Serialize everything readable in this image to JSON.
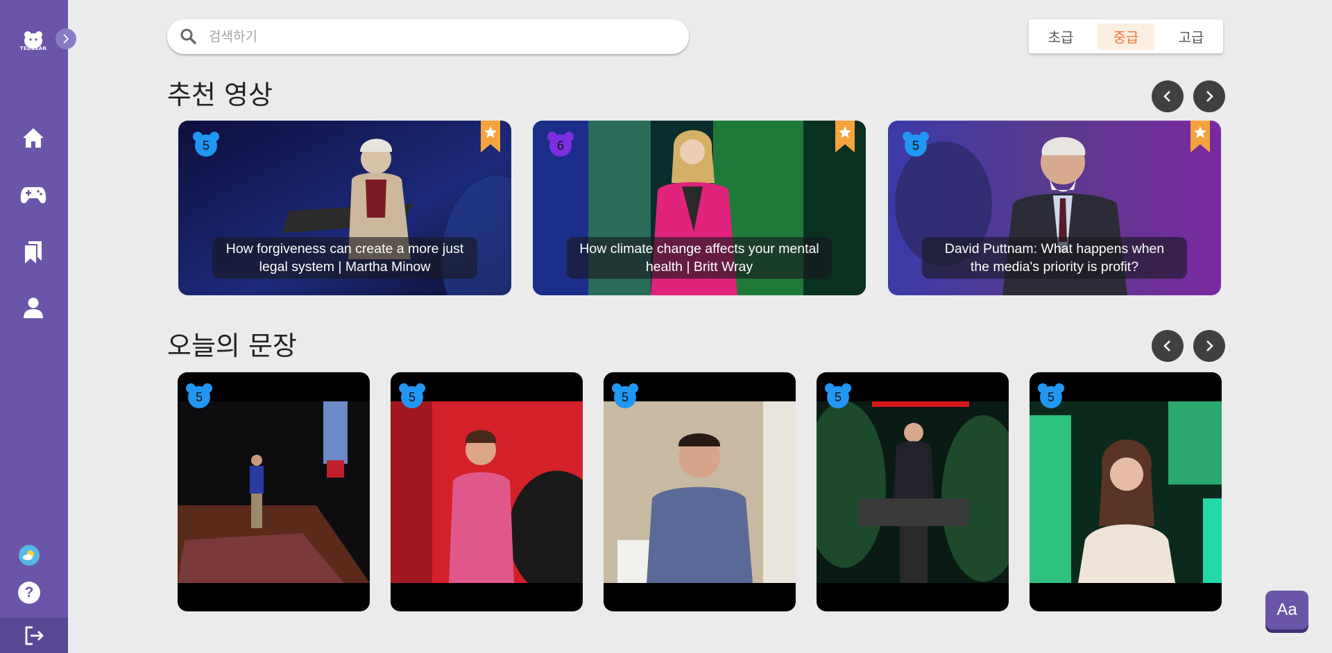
{
  "sidebar": {
    "logo_text": "TEDBEAR",
    "nav": [
      "home-icon",
      "gamepad-icon",
      "bookmarks-icon",
      "user-icon"
    ],
    "bottom": [
      "weather-icon",
      "help-icon",
      "logout-icon"
    ],
    "help_label": "?"
  },
  "search": {
    "placeholder": "검색하기",
    "value": ""
  },
  "levels": {
    "items": [
      "초급",
      "중급",
      "고급"
    ],
    "selected": "중급"
  },
  "colors": {
    "sidebar": "#6a55a8",
    "accent_orange": "#f0773b",
    "badge_blue": "#2196f3",
    "badge_purple": "#7b2fe0",
    "bookmark": "#f5a33c"
  },
  "recommended": {
    "title": "추천 영상",
    "videos": [
      {
        "level": "5",
        "caption": "How forgiveness can create a more just legal system | Martha Minow",
        "bookmarked": true
      },
      {
        "level": "6",
        "caption": "How climate change affects your mental health | Britt Wray",
        "bookmarked": true
      },
      {
        "level": "5",
        "caption": "David Puttnam: What happens when the media's priority is profit?",
        "bookmarked": true
      }
    ]
  },
  "sentences": {
    "title": "오늘의 문장",
    "cards": [
      {
        "level": "5"
      },
      {
        "level": "5"
      },
      {
        "level": "5"
      },
      {
        "level": "5"
      },
      {
        "level": "5"
      }
    ]
  },
  "font_button": {
    "label": "Aa"
  }
}
